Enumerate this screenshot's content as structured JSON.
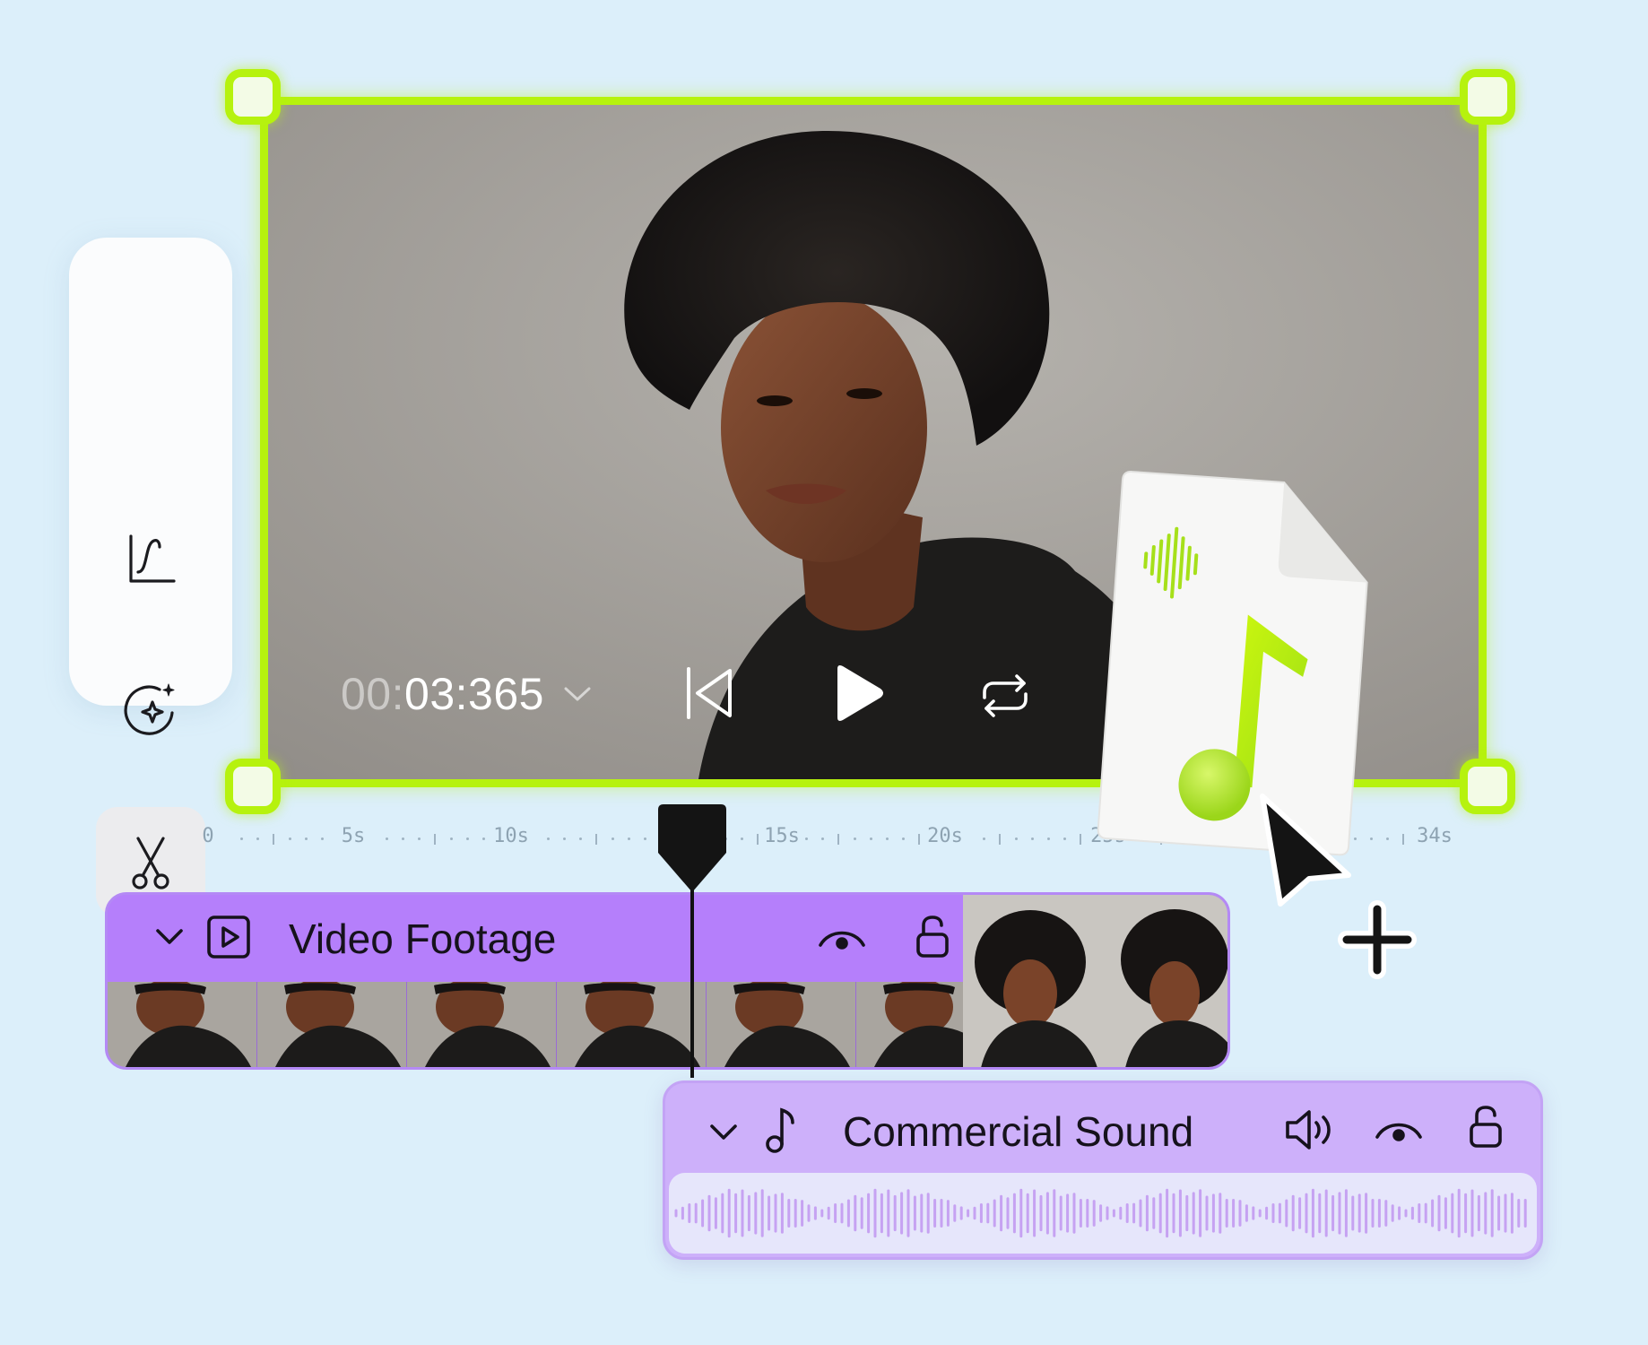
{
  "player": {
    "time_dim": "00:",
    "time_main": "03:365"
  },
  "ruler": {
    "labels": [
      "0",
      "5s",
      "10s",
      "15s",
      "20s",
      "25s",
      "34s"
    ]
  },
  "tracks": {
    "video": {
      "label": "Video Footage"
    },
    "audio": {
      "label": "Commercial Sound"
    }
  },
  "tools": [
    "curve-icon",
    "magic-enhance-icon",
    "scissors-icon"
  ],
  "colors": {
    "accent_green": "#b6f20e",
    "video_track": "#b57ffb",
    "audio_track": "#cdb0fa",
    "background": "#dceffa"
  }
}
